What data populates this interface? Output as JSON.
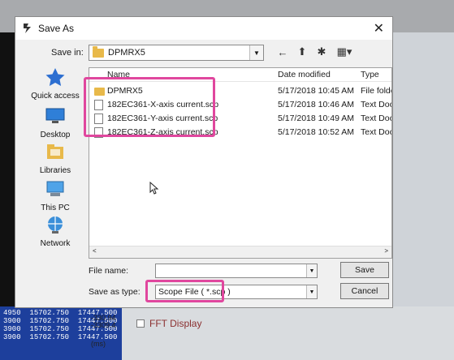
{
  "window": {
    "title": "Save As",
    "close_glyph": "✕"
  },
  "save_in": {
    "label": "Save in:",
    "value": "DPMRX5"
  },
  "toolbar": {
    "back": "←",
    "up": "⬆",
    "new_folder": "✱",
    "view": "▦▾"
  },
  "places": [
    {
      "label": "Quick access",
      "icon": "star-icon"
    },
    {
      "label": "Desktop",
      "icon": "desktop-icon"
    },
    {
      "label": "Libraries",
      "icon": "libraries-icon"
    },
    {
      "label": "This PC",
      "icon": "computer-icon"
    },
    {
      "label": "Network",
      "icon": "network-icon"
    }
  ],
  "file_list": {
    "columns": [
      "Name",
      "Date modified",
      "Type"
    ],
    "rows": [
      {
        "name": "DPMRX5",
        "date": "5/17/2018 10:45 AM",
        "type": "File folder",
        "icon": "folder-icon"
      },
      {
        "name": "182EC361-X-axis current.scp",
        "date": "5/17/2018 10:46 AM",
        "type": "Text Docu",
        "icon": "file-icon"
      },
      {
        "name": "182EC361-Y-axis current.scp",
        "date": "5/17/2018 10:49 AM",
        "type": "Text Docu",
        "icon": "file-icon"
      },
      {
        "name": "182EC361-Z-axis current.scp",
        "date": "5/17/2018 10:52 AM",
        "type": "Text Docu",
        "icon": "file-icon"
      }
    ]
  },
  "file_name": {
    "label": "File name:",
    "value": ""
  },
  "save_as_type": {
    "label": "Save as type:",
    "value": "Scope File ( *.scp )"
  },
  "buttons": {
    "save": "Save",
    "cancel": "Cancel"
  },
  "background": {
    "fft_label": "FFT Display",
    "readout": [
      "-330.94",
      "-3309.4"
    ],
    "ms_label": "(ms)",
    "table_rows": [
      [
        "4950",
        "15702.750",
        "17447.500"
      ],
      [
        "3900",
        "15702.750",
        "17447.500"
      ],
      [
        "3900",
        "15702.750",
        "17447.500"
      ],
      [
        "3900",
        "15702.750",
        "17447.500"
      ]
    ]
  },
  "colors": {
    "highlight": "#e0479e",
    "folder": "#e8b94a",
    "bg_table": "#1d3f9c"
  }
}
